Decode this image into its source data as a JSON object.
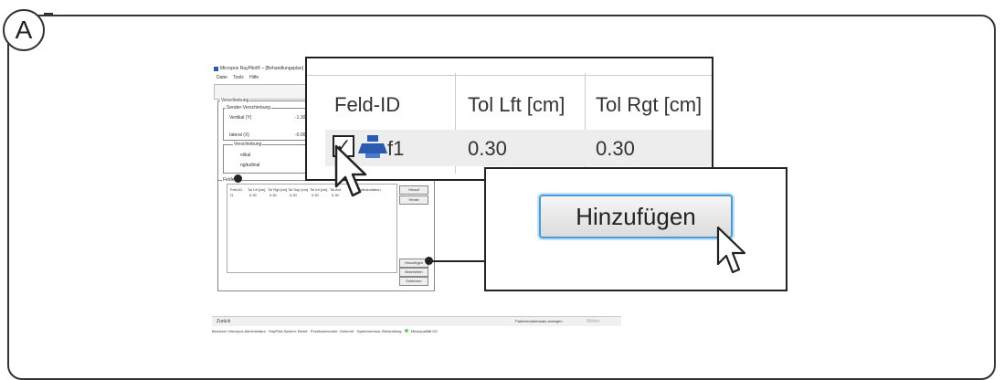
{
  "badge": "A",
  "screenshot": {
    "title": "Micropos RayPilot® – [Behandlungsplan]",
    "menu": [
      "Datei",
      "Tools",
      "Hilfe"
    ],
    "group_outer": "Verschiebung",
    "group_sender": "Sender-Verschiebung",
    "label_vertikal": "Vertikal (Y)",
    "value_vertikal": "-1.30",
    "label_lateral": "Iateral (X)",
    "value_lateral": "-0.00",
    "group_verschiebung2": "Verschiebung",
    "label_vtikal": "vtikal",
    "label_ngitudinal": "ngitudinal",
    "group_fields": "Felder",
    "grid_headers": [
      "Feld-ID",
      "Tol Lft [cm]",
      "Tol Rgt [cm]",
      "Tol Sup [cm]",
      "Tol Inf [cm]",
      "Tol Ant",
      "Symbolnotation"
    ],
    "grid_row": [
      "f1",
      "0.30",
      "0.30",
      "0.30",
      "0.30",
      "0.30"
    ],
    "side_buttons_top": [
      "Hinauf",
      "Herab"
    ],
    "side_buttons_bottom": [
      "Hinzufügen",
      "Bearbeiten",
      "Entfernen"
    ],
    "btn_back": "Zurück",
    "btn_patient": "Patientendatensatz anzeigen",
    "btn_weiter": "Weiter",
    "status": {
      "user": "Benutzer: Micropos Administrator",
      "system": "RayPilot-System: Bereit",
      "position": "Positionsmonitor: Getrennt",
      "mode": "Systemmodus: Behandlung",
      "quality": "Messqualität OK"
    }
  },
  "zoom_table": {
    "headers": [
      "Feld-ID",
      "Tol Lft [cm]",
      "Tol Rgt [cm]"
    ],
    "row": {
      "checked": true,
      "field_id": "f1",
      "tol_lft": "0.30",
      "tol_rgt": "0.30"
    },
    "checkmark": "✓"
  },
  "zoom_button": {
    "label": "Hinzufügen"
  },
  "icons": [
    "checkbox-icon",
    "field-beam-icon",
    "mouse-pointer-icon"
  ],
  "colors": {
    "button_border": "#4b9ad8",
    "button_glow": "#bfe0f6",
    "field_icon": "#2a5bb0",
    "ok_dot": "#66cc66"
  }
}
